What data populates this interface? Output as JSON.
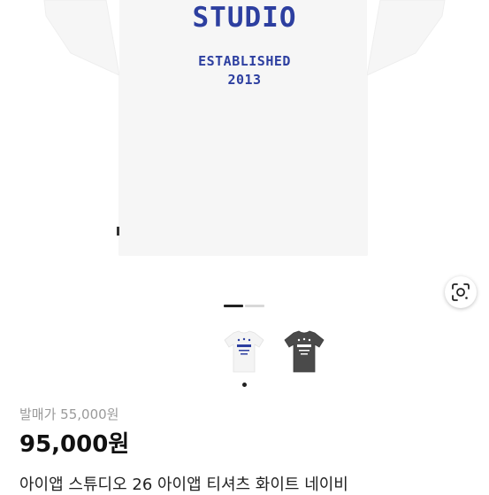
{
  "product_print": {
    "line1": "STUDIO",
    "line2": "ESTABLISHED",
    "line3": "2013"
  },
  "colors": {
    "print": "#2d3fa0",
    "shirt_white": "#f6f6f6",
    "shirt_dark": "#4a4a4a"
  },
  "gallery": {
    "page_count": 2,
    "active_index": 0
  },
  "thumbnails": [
    {
      "variant": "white"
    },
    {
      "variant": "charcoal"
    }
  ],
  "listing": {
    "original_price_label": "발매가 55,000원",
    "price": "95,000원",
    "title": "아이앱 스튜디오 26 아이앱 티셔츠 화이트 네이비"
  },
  "icons": {
    "lens": "lens-search-icon"
  }
}
